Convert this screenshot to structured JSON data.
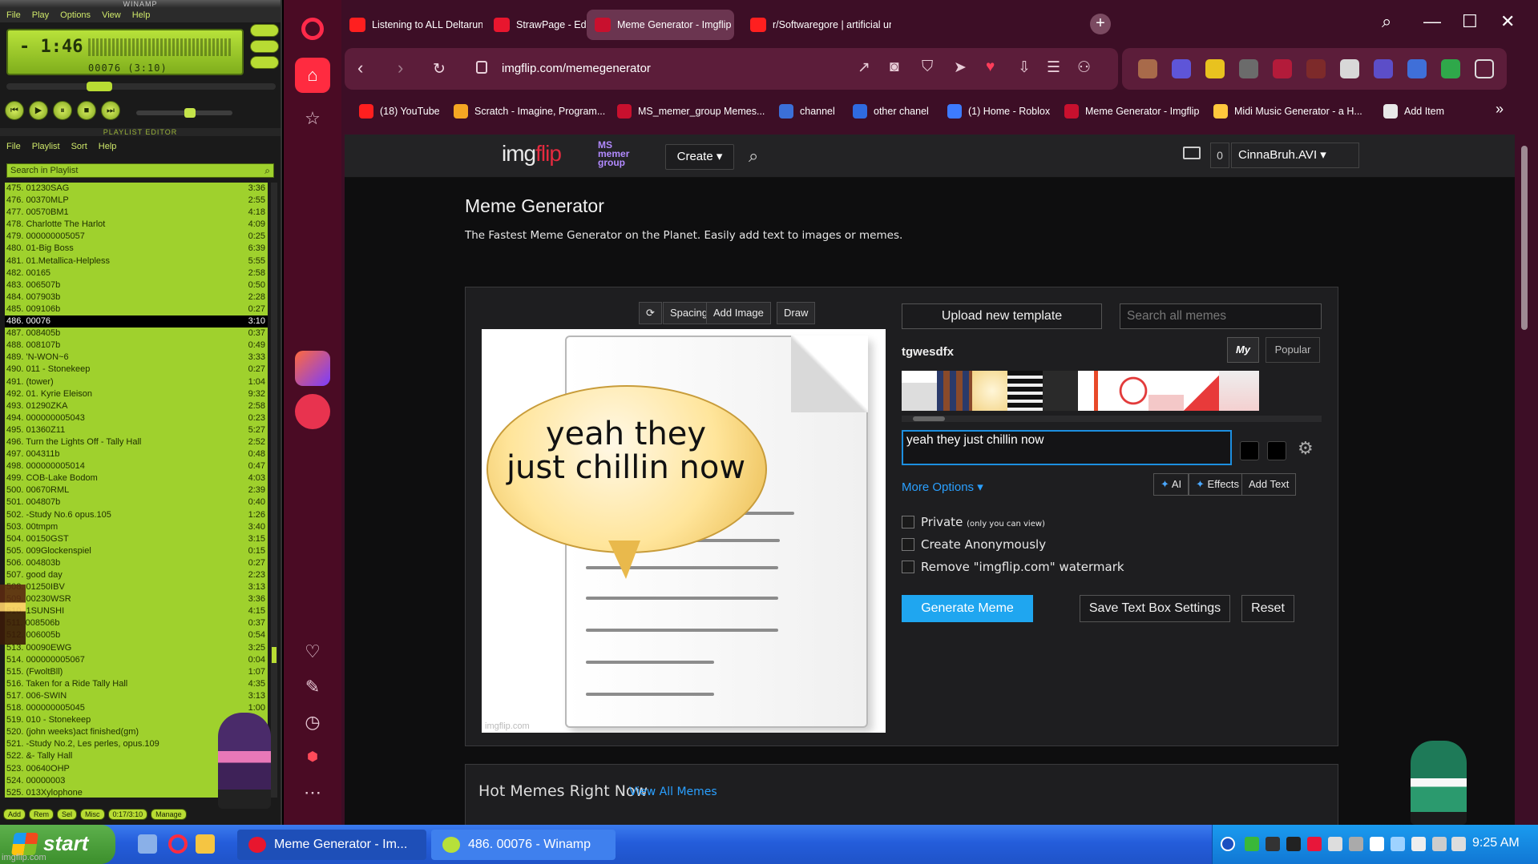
{
  "winamp": {
    "title": "WINAMP",
    "menu": [
      "File",
      "Play",
      "Options",
      "View",
      "Help"
    ],
    "time": "- 1:46",
    "track_info": "00076 (3:10)",
    "playlist_title": "PLAYLIST EDITOR",
    "playlist_menu": [
      "File",
      "Playlist",
      "Sort",
      "Help"
    ],
    "search_placeholder": "Search in Playlist",
    "footer_buttons": [
      "Add",
      "Rem",
      "Sel",
      "Misc",
      "0:17/3:10",
      "Manage"
    ],
    "playlist": [
      {
        "t": "475. 01230SAG",
        "d": "3:36"
      },
      {
        "t": "476. 00370MLP",
        "d": "2:55"
      },
      {
        "t": "477. 00570BM1",
        "d": "4:18"
      },
      {
        "t": "478. Charlotte The Harlot",
        "d": "4:09"
      },
      {
        "t": "479. 000000005057",
        "d": "0:25"
      },
      {
        "t": "480. 01-Big Boss",
        "d": "6:39"
      },
      {
        "t": "481. 01.Metallica-Helpless",
        "d": "5:55"
      },
      {
        "t": "482. 00165",
        "d": "2:58"
      },
      {
        "t": "483. 006507b",
        "d": "0:50"
      },
      {
        "t": "484. 007903b",
        "d": "2:28"
      },
      {
        "t": "485. 009106b",
        "d": "0:27"
      },
      {
        "t": "486. 00076",
        "d": "3:10"
      },
      {
        "t": "487. 008405b",
        "d": "0:37"
      },
      {
        "t": "488. 008107b",
        "d": "0:49"
      },
      {
        "t": "489. 'N-WON~6",
        "d": "3:33"
      },
      {
        "t": "490. 011 - Stonekeep",
        "d": "0:27"
      },
      {
        "t": "491. (tower)",
        "d": "1:04"
      },
      {
        "t": "492. 01. Kyrie Eleison",
        "d": "9:32"
      },
      {
        "t": "493. 01290ZKA",
        "d": "2:58"
      },
      {
        "t": "494. 000000005043",
        "d": "0:23"
      },
      {
        "t": "495. 01360Z11",
        "d": "5:27"
      },
      {
        "t": "496. Turn the Lights Off - Tally Hall",
        "d": "2:52"
      },
      {
        "t": "497. 004311b",
        "d": "0:48"
      },
      {
        "t": "498. 000000005014",
        "d": "0:47"
      },
      {
        "t": "499. COB-Lake Bodom",
        "d": "4:03"
      },
      {
        "t": "500. 00670RML",
        "d": "2:39"
      },
      {
        "t": "501. 004807b",
        "d": "0:40"
      },
      {
        "t": "502. -Study No.6 opus.105",
        "d": "1:26"
      },
      {
        "t": "503. 00tmpm",
        "d": "3:40"
      },
      {
        "t": "504. 00150GST",
        "d": "3:15"
      },
      {
        "t": "505. 009Glockenspiel",
        "d": "0:15"
      },
      {
        "t": "506. 004803b",
        "d": "0:27"
      },
      {
        "t": "507. good day",
        "d": "2:23"
      },
      {
        "t": "508. 01250IBV",
        "d": "3:13"
      },
      {
        "t": "509. 00230WSR",
        "d": "3:36"
      },
      {
        "t": "510. 1SUNSHI",
        "d": "4:15"
      },
      {
        "t": "511. 008506b",
        "d": "0:37"
      },
      {
        "t": "512. 006005b",
        "d": "0:54"
      },
      {
        "t": "513. 00090EWG",
        "d": "3:25"
      },
      {
        "t": "514. 000000005067",
        "d": "0:04"
      },
      {
        "t": "515. (FwoltBll)",
        "d": "1:07"
      },
      {
        "t": "516. Taken for a Ride  Tally Hall",
        "d": "4:35"
      },
      {
        "t": "517. 006-SWIN",
        "d": "3:13"
      },
      {
        "t": "518. 000000005045",
        "d": "1:00"
      },
      {
        "t": "519. 010 - Stonekeep",
        "d": ""
      },
      {
        "t": "520. (john weeks)act finished(gm)",
        "d": ""
      },
      {
        "t": "521. -Study No.2, Les perles, opus.109",
        "d": ""
      },
      {
        "t": "522. &- Tally Hall",
        "d": ""
      },
      {
        "t": "523. 00640OHP",
        "d": ""
      },
      {
        "t": "524. 00000003",
        "d": ""
      },
      {
        "t": "525. 013Xylophone",
        "d": ""
      }
    ],
    "selected_index": 11
  },
  "browser": {
    "tabs": [
      {
        "label": "Listening to ALL Deltarune Chapter",
        "color": "#ff1f1f"
      },
      {
        "label": "StrawPage - Editor",
        "color": "#e8162e"
      },
      {
        "label": "Meme Generator - Imgflip",
        "color": "#c8102e",
        "active": true
      },
      {
        "label": "r/Softwaregore | artificial unin",
        "color": "#ff1f1f"
      }
    ],
    "url": "imgflip.com/memegenerator",
    "bookmarks": [
      {
        "label": "(18) YouTube",
        "color": "#ff1f1f"
      },
      {
        "label": "Scratch - Imagine, Program...",
        "color": "#f5a623"
      },
      {
        "label": "MS_memer_group Memes...",
        "color": "#c8102e"
      },
      {
        "label": "channel",
        "color": "#3b6fd8"
      },
      {
        "label": "other chanel",
        "color": "#2f6be0"
      },
      {
        "label": "(1) Home - Roblox",
        "color": "#3d7bff"
      },
      {
        "label": "Meme Generator - Imgflip",
        "color": "#c8102e"
      },
      {
        "label": "Midi Music Generator - a H...",
        "color": "#ffc83d"
      },
      {
        "label": "Add Item",
        "color": "#e8e8e8"
      }
    ]
  },
  "imgflip": {
    "logo_left": "img",
    "logo_right": "flip",
    "group_logo": [
      "MS",
      "memer",
      "group"
    ],
    "create_label": "Create ▾",
    "notif_count": "0",
    "username": "CinnaBruh.AVI ▾",
    "title": "Meme Generator",
    "subtitle": "The Fastest Meme Generator on the Planet. Easily add text to images or memes.",
    "tools": [
      "⟳",
      "Spacing",
      "Add Image",
      "Draw"
    ],
    "meme_text_line1": "yeah they",
    "meme_text_line2": "just chillin now",
    "watermark": "imgflip.com",
    "upload_label": "Upload new template",
    "search_placeholder": "Search all memes",
    "template_name": "tgwesdfx",
    "tab_my": "My",
    "tab_popular": "Popular",
    "text_box_value": "yeah they just chillin now",
    "more_options": "More Options ▾",
    "ai_label": "AI",
    "effects_label": "Effects",
    "add_text_label": "Add Text",
    "private_label": "Private",
    "private_note": "(only you can view)",
    "anon_label": "Create Anonymously",
    "watermark_label": "Remove \"imgflip.com\" watermark",
    "generate_label": "Generate Meme",
    "save_label": "Save Text Box Settings",
    "reset_label": "Reset",
    "hot_title": "Hot Memes Right Now",
    "view_all": "View All Memes"
  },
  "taskbar": {
    "start_label": "start",
    "tasks": [
      {
        "label": "Meme Generator - Im...",
        "color": "#e8162e"
      },
      {
        "label": "486. 00076 - Winamp",
        "color": "#b7e03a"
      }
    ],
    "clock": "9:25 AM"
  },
  "corner_watermark": "imgflip.com",
  "colors": {
    "accent_blue": "#1fa6f0",
    "opera_red": "#ff2b40",
    "winamp_green": "#9fd12d"
  }
}
